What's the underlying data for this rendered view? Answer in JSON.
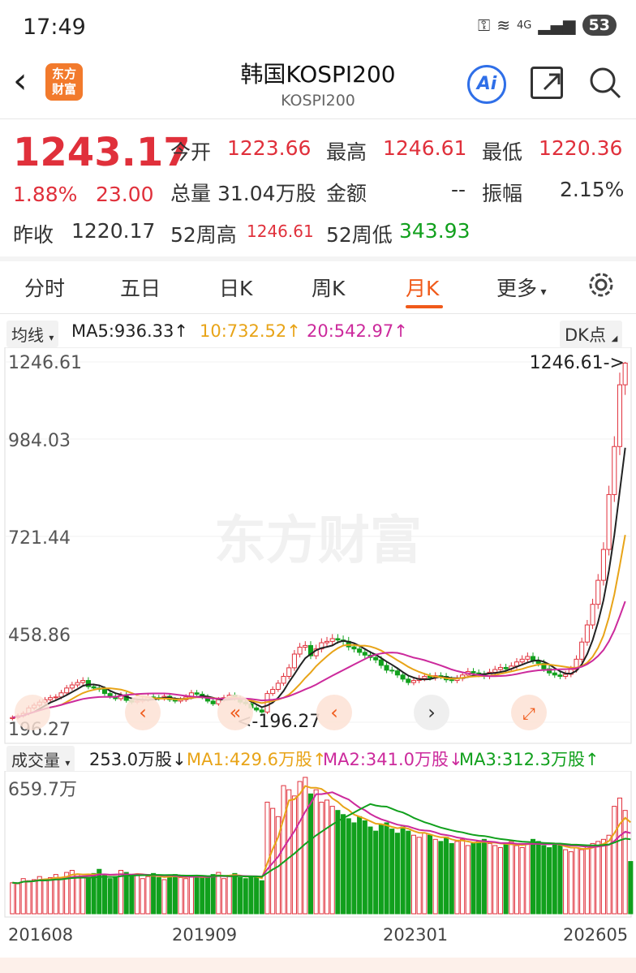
{
  "status": {
    "time": "17:49",
    "network": "4G",
    "battery": "53"
  },
  "header": {
    "title": "韩国KOSPI200",
    "subtitle": "KOSPI200",
    "logo": "东方财富",
    "ai": "Ai"
  },
  "quote": {
    "price": "1243.17",
    "change_pct": "1.88%",
    "change_val": "23.00",
    "open_label": "今开",
    "open": "1223.66",
    "high_label": "最高",
    "high": "1246.61",
    "low_label": "最低",
    "low": "1220.36",
    "volume_label": "总量",
    "volume": "31.04万股",
    "amount_label": "金额",
    "amount": "--",
    "amplitude_label": "振幅",
    "amplitude": "2.15%",
    "prev_close_label": "昨收",
    "prev_close": "1220.17",
    "wk52_high_label": "52周高",
    "wk52_high": "1246.61",
    "wk52_low_label": "52周低",
    "wk52_low": "343.93"
  },
  "tabs": [
    "分时",
    "五日",
    "日K",
    "周K",
    "月K",
    "更多"
  ],
  "active_tab": "月K",
  "ma_bar": {
    "selector": "均线",
    "ma5": "MA5:936.33↑",
    "ma10": "10:732.52↑",
    "ma20": "20:542.97↑",
    "dk": "DK点"
  },
  "price_axis": [
    "1246.61",
    "984.03",
    "721.44",
    "458.86",
    "196.27"
  ],
  "annotations": {
    "max": "1246.61->",
    "min": "<-196.27"
  },
  "watermark": "东方财富",
  "vol_bar": {
    "selector": "成交量",
    "current": "253.0万股↓",
    "ma1": "MA1:429.6万股↑",
    "ma2": "MA2:341.0万股↓",
    "ma3": "MA3:312.3万股↑",
    "axis_max": "659.7万"
  },
  "x_axis": [
    "201608",
    "201909",
    "202301",
    "202605"
  ],
  "colors": {
    "up": "#e0303b",
    "down": "#11a01d",
    "ma5": "#222222",
    "ma10": "#e8a418",
    "ma20": "#cc2a9c",
    "accent": "#f05a1a"
  },
  "chart_data": {
    "type": "candlestick",
    "period": "monthly",
    "y_range": [
      196.27,
      1246.61
    ],
    "close": [
      210,
      215,
      222,
      238,
      246,
      255,
      262,
      268,
      270,
      282,
      296,
      305,
      312,
      318,
      300,
      296,
      292,
      280,
      272,
      265,
      276,
      260,
      255,
      258,
      262,
      270,
      268,
      266,
      272,
      262,
      258,
      262,
      270,
      282,
      278,
      270,
      258,
      250,
      262,
      268,
      275,
      266,
      255,
      250,
      238,
      232,
      226,
      280,
      292,
      310,
      330,
      355,
      395,
      415,
      420,
      390,
      410,
      428,
      432,
      440,
      436,
      432,
      416,
      410,
      400,
      392,
      385,
      378,
      362,
      348,
      346,
      334,
      322,
      312,
      318,
      324,
      330,
      326,
      332,
      330,
      320,
      318,
      324,
      334,
      344,
      340,
      336,
      330,
      342,
      350,
      356,
      352,
      360,
      372,
      380,
      388,
      376,
      368,
      352,
      340,
      334,
      330,
      336,
      350,
      380,
      430,
      480,
      540,
      610,
      700,
      860,
      1000,
      1180,
      1243.17
    ],
    "volume": [
      150,
      145,
      170,
      160,
      165,
      180,
      160,
      175,
      190,
      170,
      200,
      210,
      190,
      180,
      175,
      195,
      215,
      185,
      170,
      180,
      210,
      200,
      185,
      190,
      170,
      180,
      195,
      175,
      165,
      185,
      190,
      175,
      170,
      180,
      185,
      175,
      180,
      190,
      200,
      170,
      185,
      195,
      175,
      170,
      180,
      175,
      160,
      540,
      510,
      470,
      620,
      600,
      570,
      640,
      660,
      580,
      600,
      540,
      550,
      520,
      500,
      480,
      460,
      440,
      470,
      450,
      420,
      400,
      430,
      440,
      410,
      390,
      420,
      400,
      380,
      370,
      390,
      380,
      360,
      350,
      370,
      340,
      350,
      360,
      330,
      340,
      350,
      360,
      340,
      330,
      320,
      340,
      350,
      330,
      320,
      340,
      360,
      350,
      330,
      320,
      340,
      330,
      310,
      300,
      320,
      310,
      330,
      340,
      350,
      360,
      380,
      520,
      560,
      500,
      253
    ]
  }
}
